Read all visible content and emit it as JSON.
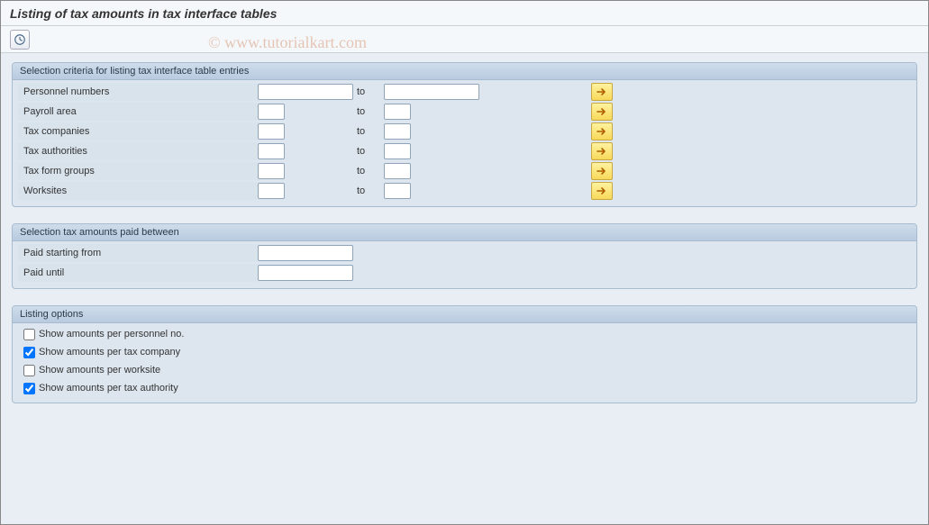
{
  "page": {
    "title": "Listing of tax amounts in tax interface tables"
  },
  "watermark": "© www.tutorialkart.com",
  "groups": {
    "selection_criteria": {
      "title": "Selection criteria for listing tax interface table entries",
      "rows": [
        {
          "label": "Personnel numbers",
          "from_size": "med",
          "to_size": "med"
        },
        {
          "label": "Payroll area",
          "from_size": "small",
          "to_size": "small"
        },
        {
          "label": "Tax companies",
          "from_size": "small",
          "to_size": "small"
        },
        {
          "label": "Tax authorities",
          "from_size": "small",
          "to_size": "small"
        },
        {
          "label": "Tax form groups",
          "from_size": "small",
          "to_size": "small"
        },
        {
          "label": "Worksites",
          "from_size": "small",
          "to_size": "small"
        }
      ],
      "to_label": "to"
    },
    "paid_between": {
      "title": "Selection tax amounts paid between",
      "rows": [
        {
          "label": "Paid starting from"
        },
        {
          "label": "Paid until"
        }
      ]
    },
    "listing_options": {
      "title": "Listing options",
      "checkboxes": [
        {
          "label": "Show amounts per personnel no.",
          "checked": false
        },
        {
          "label": "Show amounts per tax company",
          "checked": true
        },
        {
          "label": "Show amounts per worksite",
          "checked": false
        },
        {
          "label": "Show amounts per tax authority",
          "checked": true
        }
      ]
    }
  }
}
